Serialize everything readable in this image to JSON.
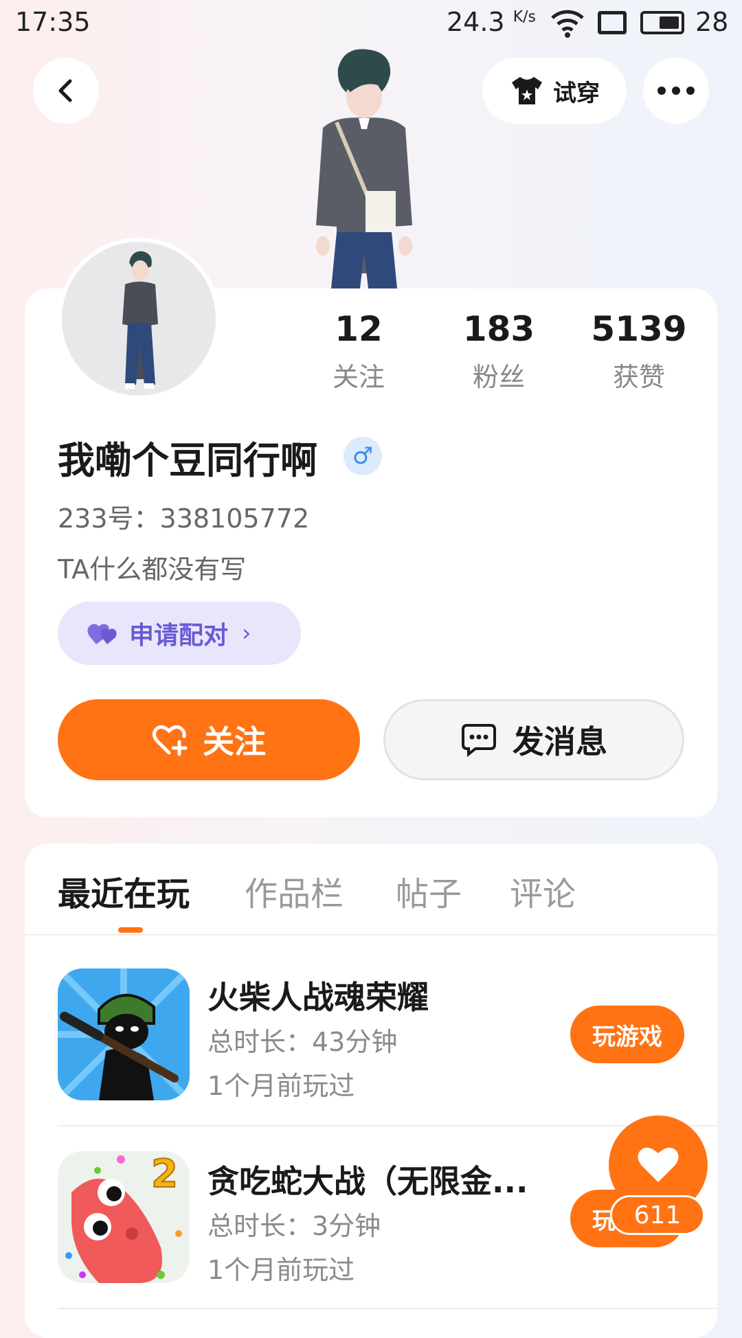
{
  "status_bar": {
    "time": "17:35",
    "speed": "24.3",
    "speed_unit": "K/s",
    "battery": "28"
  },
  "header": {
    "tryon_label": "试穿"
  },
  "profile": {
    "stats": [
      {
        "value": "12",
        "label": "关注"
      },
      {
        "value": "183",
        "label": "粉丝"
      },
      {
        "value": "5139",
        "label": "获赞"
      }
    ],
    "username": "我嘞个豆同行啊",
    "gender_symbol": "♂",
    "uid": "233号：338105772",
    "bio": "TA什么都没有写",
    "pair_label": "申请配对",
    "follow_label": "关注",
    "message_label": "发消息"
  },
  "tabs": [
    {
      "label": "最近在玩",
      "active": true
    },
    {
      "label": "作品栏",
      "active": false
    },
    {
      "label": "帖子",
      "active": false
    },
    {
      "label": "评论",
      "active": false
    }
  ],
  "games": [
    {
      "title": "火柴人战魂荣耀",
      "duration": "总时长：43分钟",
      "last_played": "1个月前玩过",
      "button": "玩游戏"
    },
    {
      "title": "贪吃蛇大战（无限金...",
      "duration": "总时长：3分钟",
      "last_played": "1个月前玩过",
      "button": "玩游戏"
    }
  ],
  "like": {
    "count": "611"
  },
  "colors": {
    "accent": "#ff7315",
    "pair_bg": "#e8e6fb",
    "pair_text": "#6a5ad4",
    "gender": "#3b8ee8"
  }
}
